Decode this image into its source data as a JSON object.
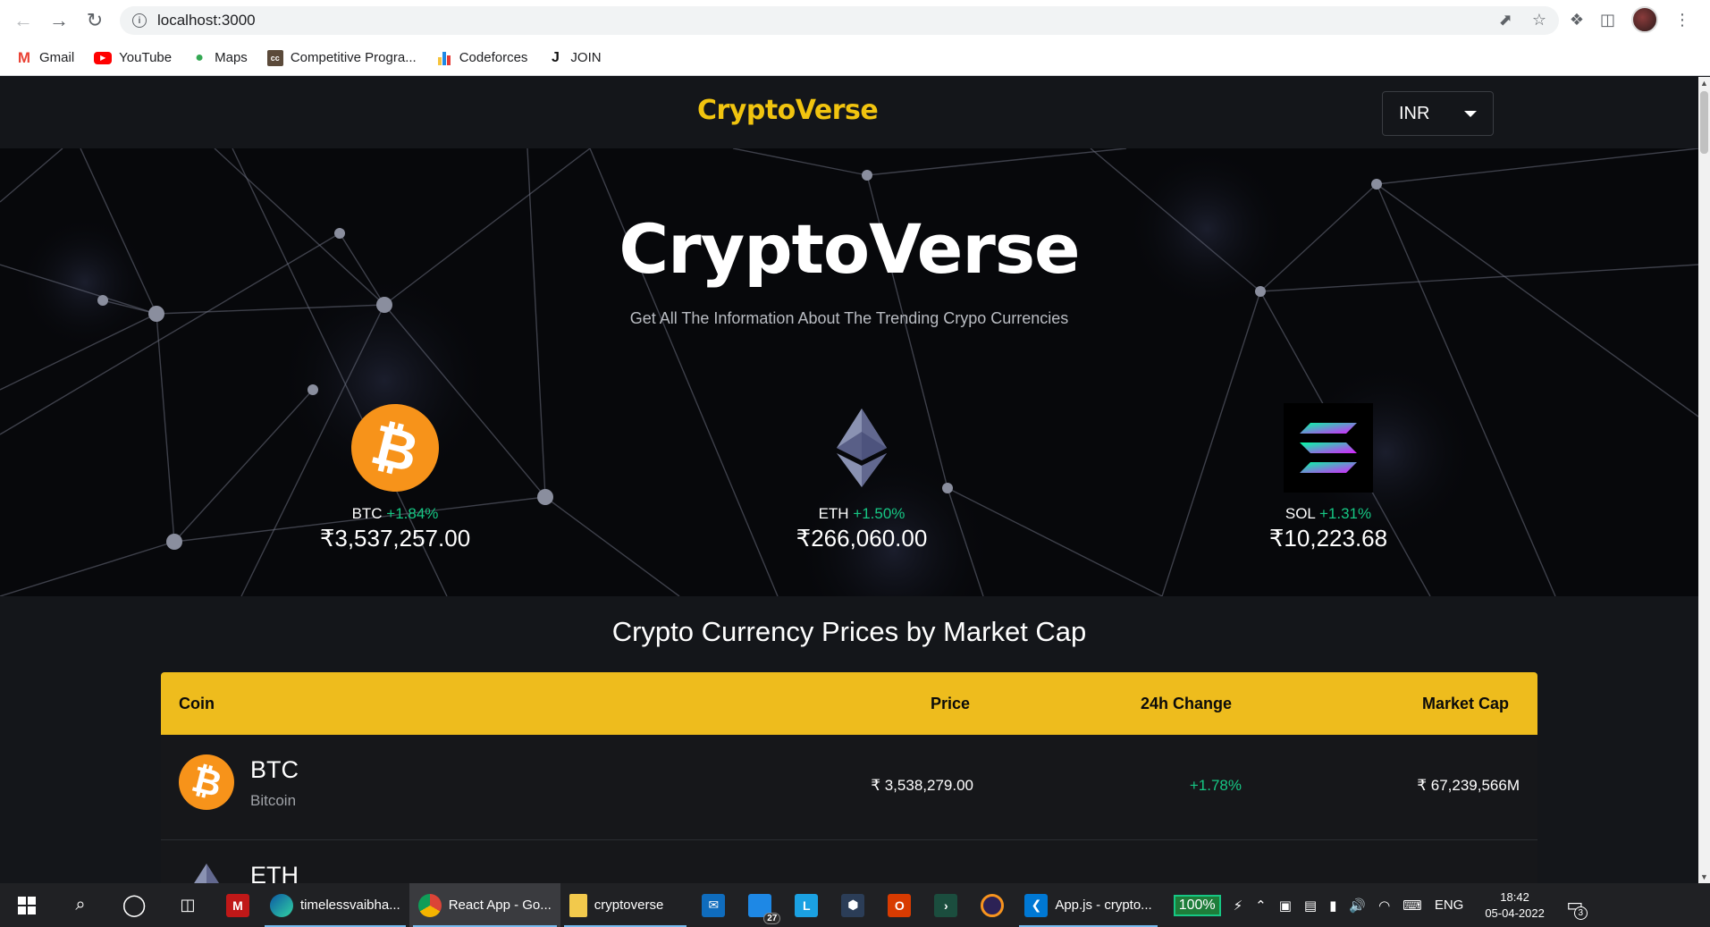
{
  "browser": {
    "url": "localhost:3000",
    "bookmarks": [
      {
        "label": "Gmail",
        "icon": "gmail-icon"
      },
      {
        "label": "YouTube",
        "icon": "youtube-icon"
      },
      {
        "label": "Maps",
        "icon": "maps-icon"
      },
      {
        "label": "Competitive Progra...",
        "icon": "codechef-icon"
      },
      {
        "label": "Codeforces",
        "icon": "codeforces-icon"
      },
      {
        "label": "JOIN",
        "icon": "join-icon"
      }
    ]
  },
  "header": {
    "brand": "CryptoVerse",
    "currency": "INR"
  },
  "banner": {
    "title": "CryptoVerse",
    "subtitle": "Get All The Information About The Trending Crypo Currencies",
    "trending": [
      {
        "symbol": "BTC",
        "change": "+1.84%",
        "price": "₹3,537,257.00"
      },
      {
        "symbol": "ETH",
        "change": "+1.50%",
        "price": "₹266,060.00"
      },
      {
        "symbol": "SOL",
        "change": "+1.31%",
        "price": "₹10,223.68"
      }
    ]
  },
  "table": {
    "title": "Crypto Currency Prices by Market Cap",
    "headers": {
      "coin": "Coin",
      "price": "Price",
      "change": "24h Change",
      "market_cap": "Market Cap"
    },
    "rows": [
      {
        "symbol": "BTC",
        "name": "Bitcoin",
        "price": "₹ 3,538,279.00",
        "change": "+1.78%",
        "market_cap": "₹ 67,239,566M"
      },
      {
        "symbol": "ETH",
        "name": "",
        "price": "",
        "change": "",
        "market_cap": ""
      }
    ]
  },
  "taskbar": {
    "apps": [
      {
        "label": "timelessvaibha...",
        "icon": "edge-icon"
      },
      {
        "label": "React App - Go...",
        "icon": "chrome-icon"
      },
      {
        "label": "cryptoverse",
        "icon": "folder-icon"
      },
      {
        "label": "App.js - crypto...",
        "icon": "vscode-icon"
      }
    ],
    "mail_badge": "27",
    "battery": "100%",
    "language": "ENG",
    "time": "18:42",
    "date": "05-04-2022",
    "notifications": "3"
  },
  "colors": {
    "accent": "#eebc1d",
    "brand": "#f1c40f",
    "positive": "#16c784",
    "background": "#14161a",
    "btc": "#f7931a"
  }
}
